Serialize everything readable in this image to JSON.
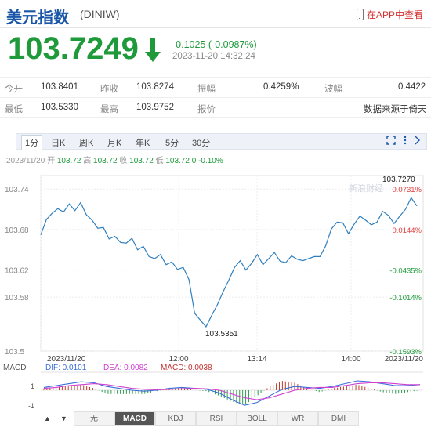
{
  "header": {
    "title": "美元指数",
    "code": "(DINIW)",
    "app_link": "在APP中查看"
  },
  "quote": {
    "price": "103.7249",
    "change": "-0.1025 (-0.0987%)",
    "time": "2023-11-20 14:32:24",
    "color": "#1f9a3b"
  },
  "stats": {
    "row1": [
      {
        "label": "今开",
        "value": "103.8401"
      },
      {
        "label": "昨收",
        "value": "103.8274"
      },
      {
        "label": "振幅",
        "value": "0.4259%"
      },
      {
        "label": "波幅",
        "value": "0.4422"
      }
    ],
    "row2": [
      {
        "label": "最低",
        "value": "103.5330"
      },
      {
        "label": "最高",
        "value": "103.9752"
      },
      {
        "label": "报价",
        "value": "数据来源于倚天"
      }
    ]
  },
  "tabs": [
    "1分",
    "日K",
    "周K",
    "月K",
    "年K",
    "5分",
    "30分"
  ],
  "active_tab": "1分",
  "info_line": {
    "prefix": "2023/11/20 开",
    "open": "103.72",
    "high_label": "高",
    "high": "103.72",
    "close_label": "收",
    "close": "103.72",
    "low_label": "低",
    "low": "103.72",
    "change": "0",
    "pct": "-0.10%"
  },
  "chart_data": {
    "type": "line",
    "y_labels_left": [
      "103.74",
      "103.68",
      "103.62",
      "103.58",
      "103.5"
    ],
    "y_labels_right": [
      "0.0731%",
      "0.0144%",
      "-0.0435%",
      "-0.1014%",
      "-0.1593%"
    ],
    "x_labels": [
      "2023/11/20",
      "12:00",
      "13:14",
      "14:00",
      "2023/11/20"
    ],
    "ylim": [
      103.5,
      103.76
    ],
    "annotation_high": "103.7270",
    "annotation_low": "103.5351",
    "watermark": "新浪财经",
    "series": [
      {
        "values": [
          103.672,
          103.695,
          103.704,
          103.711,
          103.706,
          103.718,
          103.708,
          103.72,
          103.702,
          103.694,
          103.682,
          103.683,
          103.666,
          103.67,
          103.661,
          103.66,
          103.667,
          103.65,
          103.655,
          103.64,
          103.637,
          103.643,
          103.628,
          103.632,
          103.621,
          103.624,
          103.606,
          103.556,
          103.546,
          103.536,
          103.553,
          103.569,
          103.588,
          103.605,
          103.624,
          103.634,
          103.62,
          103.63,
          103.643,
          103.628,
          103.637,
          103.646,
          103.633,
          103.631,
          103.641,
          103.636,
          103.634,
          103.637,
          103.64,
          103.64,
          103.656,
          103.681,
          103.691,
          103.69,
          103.674,
          103.688,
          103.7,
          103.694,
          103.687,
          103.691,
          103.707,
          103.701,
          103.689,
          103.7,
          103.71,
          103.727,
          103.715
        ]
      }
    ],
    "macd": {
      "label": "MACD",
      "dif_label": "DIF: 0.0101",
      "dea_label": "DEA: 0.0082",
      "macd_label": "MACD: 0.0038",
      "y_ticks": [
        "1",
        "-1"
      ],
      "dif": [
        0.3,
        0.5,
        0.7,
        0.9,
        0.8,
        0.4,
        0.2,
        0.0,
        -0.1,
        0.0,
        0.2,
        0.3,
        0.2,
        0.1,
        -0.3,
        -1.0,
        -1.6,
        -1.3,
        -0.6,
        0.1,
        0.4,
        0.3,
        0.2,
        0.4,
        0.7,
        1.0,
        0.9,
        0.7,
        0.5,
        0.5,
        0.6
      ],
      "dea": [
        0.2,
        0.3,
        0.5,
        0.6,
        0.7,
        0.6,
        0.4,
        0.2,
        0.1,
        0.05,
        0.1,
        0.15,
        0.2,
        0.15,
        0.0,
        -0.4,
        -0.8,
        -1.0,
        -0.8,
        -0.4,
        0.0,
        0.2,
        0.3,
        0.3,
        0.5,
        0.7,
        0.8,
        0.8,
        0.7,
        0.6,
        0.6
      ]
    }
  },
  "indicators": [
    "无",
    "MACD",
    "KDJ",
    "RSI",
    "BOLL",
    "WR",
    "DMI"
  ],
  "active_indicator": "MACD",
  "nav": [
    "▲",
    "▼"
  ]
}
